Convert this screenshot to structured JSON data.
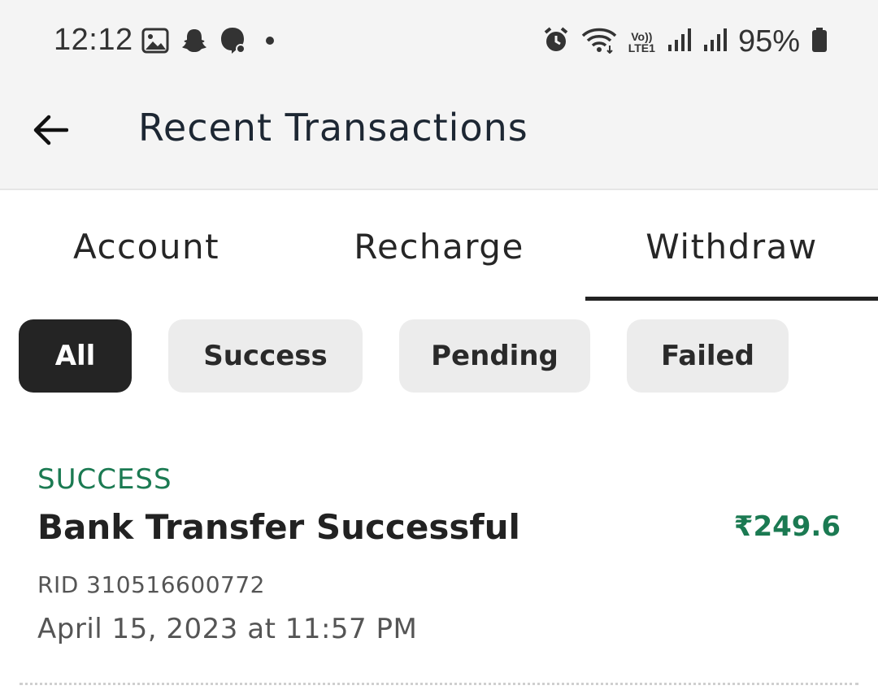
{
  "status_bar": {
    "time": "12:12",
    "left_icons": [
      "gallery-icon",
      "snapchat-icon",
      "chat-icon",
      "dot-icon"
    ],
    "right_icons": [
      "alarm-icon",
      "wifi-icon",
      "volte-icon",
      "signal-icon",
      "signal-icon",
      "battery-icon"
    ],
    "volte_label_top": "Vo))",
    "volte_label_bottom": "LTE1",
    "battery": "95%"
  },
  "app_bar": {
    "back_icon": "arrow-left-icon",
    "title": "Recent Transactions"
  },
  "tabs": [
    {
      "label": "Account",
      "active": false
    },
    {
      "label": "Recharge",
      "active": false
    },
    {
      "label": "Withdraw",
      "active": true
    }
  ],
  "filters": [
    {
      "label": "All",
      "active": true
    },
    {
      "label": "Success",
      "active": false
    },
    {
      "label": "Pending",
      "active": false
    },
    {
      "label": "Failed",
      "active": false
    }
  ],
  "transactions": [
    {
      "status": "SUCCESS",
      "title": "Bank Transfer Successful",
      "amount": "₹249.6",
      "rid": "RID 310516600772",
      "date": "April 15, 2023 at 11:57 PM"
    }
  ],
  "colors": {
    "success": "#1b7a52",
    "chip_active": "#242424",
    "chip_inactive": "#ececec",
    "topbar": "#f4f4f4"
  }
}
